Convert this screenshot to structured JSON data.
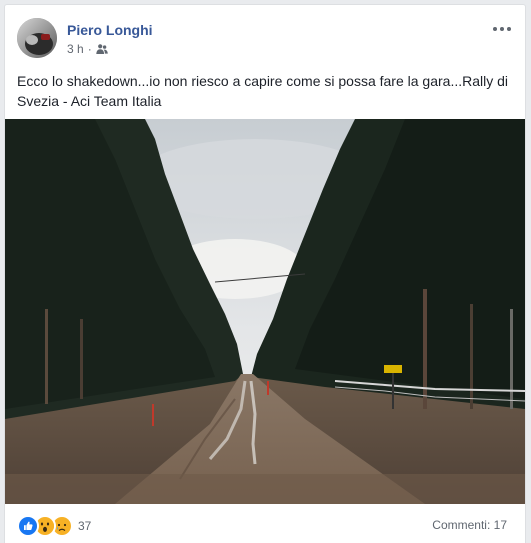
{
  "post": {
    "author": "Piero Longhi",
    "time": "3 h",
    "separator": "·",
    "audience_icon": "friends-icon",
    "text": "Ecco lo shakedown...io non riesco a capire come si possa fare la gara...Rally di Svezia - Aci Team Italia",
    "reactions": {
      "icons": [
        "like-icon",
        "wow-icon",
        "sad-icon"
      ],
      "count": "37"
    },
    "comments": "Commenti: 17",
    "colors": {
      "author": "#385898",
      "like": "#1877f2",
      "wow": "#f7b125",
      "secondary_text": "#606770"
    }
  }
}
